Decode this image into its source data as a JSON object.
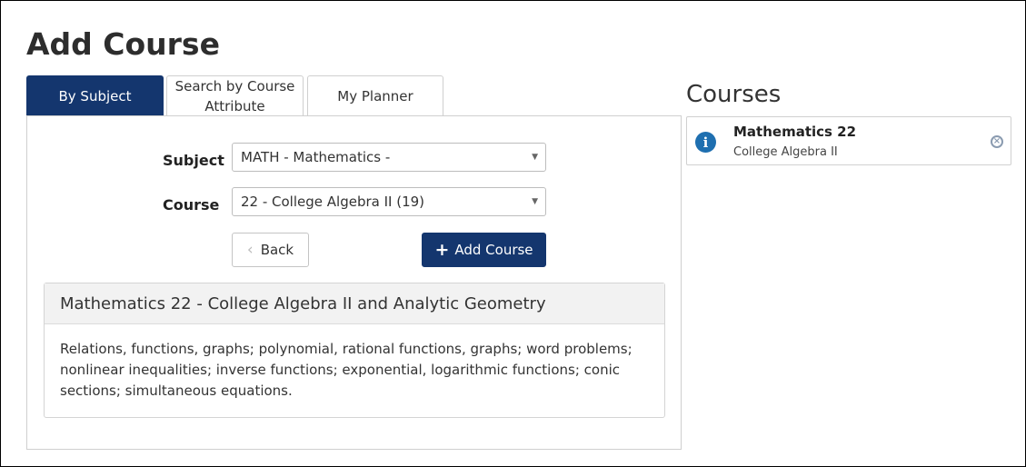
{
  "page": {
    "title": "Add Course"
  },
  "tabs": [
    {
      "label": "By Subject",
      "active": true
    },
    {
      "label": "Search by Course Attribute",
      "active": false
    },
    {
      "label": "My Planner",
      "active": false
    }
  ],
  "form": {
    "subject_label": "Subject",
    "subject_value": "MATH - Mathematics -",
    "course_label": "Course",
    "course_value": "22 - College Algebra II (19)",
    "back_label": "Back",
    "add_label": "Add Course"
  },
  "description": {
    "title": "Mathematics 22 - College Algebra II and Analytic Geometry",
    "body": "Relations, functions, graphs; polynomial, rational functions, graphs; word problems; nonlinear inequalities; inverse functions; exponential, logarithmic functions; conic sections; simultaneous equations."
  },
  "courses": {
    "title": "Courses",
    "items": [
      {
        "name": "Mathematics 22",
        "subtitle": "College Algebra II",
        "icon": "info-icon"
      }
    ]
  },
  "colors": {
    "primary": "#14366e",
    "info": "#1e6fb0",
    "border": "#cfcfcf"
  }
}
